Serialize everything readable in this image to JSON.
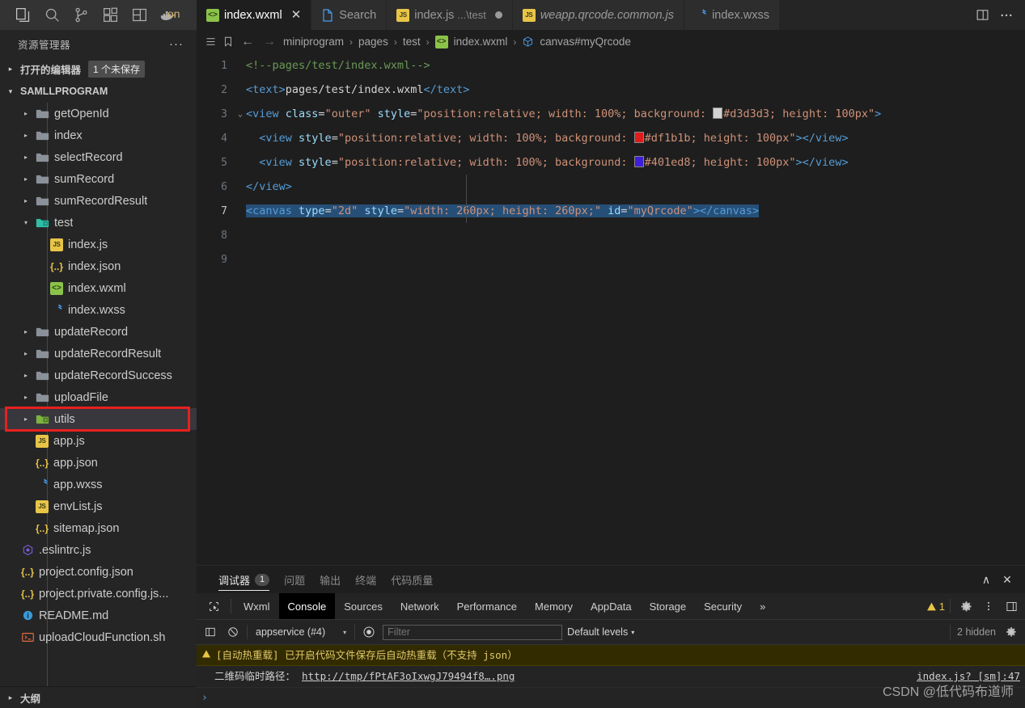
{
  "activity_bar": {
    "icons": [
      "explorer-icon",
      "search-icon",
      "source-control-icon",
      "extensions-icon",
      "layout-icon",
      "docker-icon"
    ],
    "overflow_label": "on"
  },
  "tabs": [
    {
      "label": "index.wxml",
      "sublabel": "",
      "icon": "wxml-file-icon",
      "active": true,
      "close": "✕",
      "dirty": false,
      "italic": false
    },
    {
      "label": "Search",
      "sublabel": "",
      "icon": "page-file-icon",
      "active": false,
      "close": "",
      "dirty": false,
      "italic": false
    },
    {
      "label": "index.js",
      "sublabel": "...\\test",
      "icon": "js-file-icon",
      "active": false,
      "close": "",
      "dirty": true,
      "italic": false
    },
    {
      "label": "weapp.qrcode.common.js",
      "sublabel": "",
      "icon": "js-file-icon",
      "active": false,
      "close": "",
      "dirty": false,
      "italic": true
    },
    {
      "label": "index.wxss",
      "sublabel": "",
      "icon": "wxss-file-icon",
      "active": false,
      "close": "",
      "dirty": false,
      "italic": false
    }
  ],
  "tab_actions": [
    "split-editor-icon",
    "more-actions-icon"
  ],
  "sidebar": {
    "title": "资源管理器",
    "more_label": "···",
    "open_editors": {
      "label": "打开的编辑器",
      "badge": "1 个未保存",
      "twisty": "▸"
    },
    "project": {
      "label": "SAMLLPROGRAM",
      "twisty": "▾"
    },
    "outline": {
      "label": "大纲",
      "twisty": "▸"
    },
    "tree": [
      {
        "label": "getOpenId",
        "type": "folder",
        "depth": 2,
        "twisty": "▸",
        "selected": false
      },
      {
        "label": "index",
        "type": "folder",
        "depth": 2,
        "twisty": "▸",
        "selected": false
      },
      {
        "label": "selectRecord",
        "type": "folder",
        "depth": 2,
        "twisty": "▸",
        "selected": false
      },
      {
        "label": "sumRecord",
        "type": "folder",
        "depth": 2,
        "twisty": "▸",
        "selected": false
      },
      {
        "label": "sumRecordResult",
        "type": "folder",
        "depth": 2,
        "twisty": "▸",
        "selected": false
      },
      {
        "label": "test",
        "type": "folder-open-active",
        "depth": 2,
        "twisty": "▾",
        "selected": false
      },
      {
        "label": "index.js",
        "type": "js",
        "depth": 3,
        "twisty": "",
        "selected": false
      },
      {
        "label": "index.json",
        "type": "json",
        "depth": 3,
        "twisty": "",
        "selected": false
      },
      {
        "label": "index.wxml",
        "type": "wxml",
        "depth": 3,
        "twisty": "",
        "selected": false
      },
      {
        "label": "index.wxss",
        "type": "wxss",
        "depth": 3,
        "twisty": "",
        "selected": false
      },
      {
        "label": "updateRecord",
        "type": "folder",
        "depth": 2,
        "twisty": "▸",
        "selected": false
      },
      {
        "label": "updateRecordResult",
        "type": "folder",
        "depth": 2,
        "twisty": "▸",
        "selected": false
      },
      {
        "label": "updateRecordSuccess",
        "type": "folder",
        "depth": 2,
        "twisty": "▸",
        "selected": false
      },
      {
        "label": "uploadFile",
        "type": "folder",
        "depth": 2,
        "twisty": "▸",
        "selected": false
      },
      {
        "label": "utils",
        "type": "folder-green",
        "depth": 2,
        "twisty": "▸",
        "selected": true
      },
      {
        "label": "app.js",
        "type": "js",
        "depth": 2,
        "twisty": "",
        "selected": false
      },
      {
        "label": "app.json",
        "type": "json",
        "depth": 2,
        "twisty": "",
        "selected": false
      },
      {
        "label": "app.wxss",
        "type": "wxss",
        "depth": 2,
        "twisty": "",
        "selected": false
      },
      {
        "label": "envList.js",
        "type": "js",
        "depth": 2,
        "twisty": "",
        "selected": false
      },
      {
        "label": "sitemap.json",
        "type": "json",
        "depth": 2,
        "twisty": "",
        "selected": false
      },
      {
        "label": ".eslintrc.js",
        "type": "eslint",
        "depth": 1,
        "twisty": "",
        "selected": false
      },
      {
        "label": "project.config.json",
        "type": "json",
        "depth": 1,
        "twisty": "",
        "selected": false
      },
      {
        "label": "project.private.config.js...",
        "type": "json",
        "depth": 1,
        "twisty": "",
        "selected": false
      },
      {
        "label": "README.md",
        "type": "md",
        "depth": 1,
        "twisty": "",
        "selected": false
      },
      {
        "label": "uploadCloudFunction.sh",
        "type": "sh",
        "depth": 1,
        "twisty": "",
        "selected": false
      }
    ],
    "highlight_color": "#e8201e"
  },
  "breadcrumbs": {
    "toggle_icon": "list-icon",
    "bookmark_icon": "bookmark-icon",
    "back_icon": "←",
    "forward_icon": "→",
    "items": [
      "miniprogram",
      "pages",
      "test",
      "index.wxml",
      "canvas#myQrcode"
    ],
    "separator": "›"
  },
  "editor": {
    "lines": [
      {
        "no": "1",
        "fold": "",
        "selected": false
      },
      {
        "no": "2",
        "fold": "",
        "selected": false
      },
      {
        "no": "3",
        "fold": "⌄",
        "selected": false
      },
      {
        "no": "4",
        "fold": "",
        "selected": false
      },
      {
        "no": "5",
        "fold": "",
        "selected": false
      },
      {
        "no": "6",
        "fold": "",
        "selected": false
      },
      {
        "no": "7",
        "fold": "",
        "selected": true
      },
      {
        "no": "8",
        "fold": "",
        "selected": false
      },
      {
        "no": "9",
        "fold": "",
        "selected": false
      }
    ],
    "line1_comment": "<!--pages/test/index.wxml-->",
    "line2": {
      "open": "<text>",
      "text": "pages/test/index.wxml",
      "close": "</text>"
    },
    "line3": {
      "tag_open": "<view",
      "attr1": "class",
      "val1": "\"outer\"",
      "attr2": "style",
      "style_prefix": "\"position:relative; width: 100%; background: ",
      "color": "#d3d3d3",
      "style_suffix": "; height: 100px\"",
      "tag_close": ">"
    },
    "line4": {
      "tag_open": "<view",
      "attr": "style",
      "style_prefix": "\"position:relative; width: 100%; background: ",
      "color": "#df1b1b",
      "style_suffix": "; height: 100px\"",
      "tag_close": ">",
      "closing": "</view>"
    },
    "line5": {
      "tag_open": "<view",
      "attr": "style",
      "style_prefix": "\"position:relative; width: 100%; background: ",
      "color": "#401ed8",
      "style_suffix": "; height: 100px\"",
      "tag_close": ">",
      "closing": "</view>"
    },
    "line6": "</view>",
    "line7": {
      "tag_open": "<canvas",
      "attr1": "type",
      "val1": "\"2d\"",
      "attr2": "style",
      "val2": "\"width: 260px; height: 260px;\"",
      "attr3": "id",
      "val3": "\"myQrcode\"",
      "tag_close": ">",
      "closing": "</canvas>"
    }
  },
  "panel": {
    "tabs": [
      {
        "label": "调试器",
        "badge": "1",
        "active": true
      },
      {
        "label": "问题",
        "badge": "",
        "active": false
      },
      {
        "label": "输出",
        "badge": "",
        "active": false
      },
      {
        "label": "终端",
        "badge": "",
        "active": false
      },
      {
        "label": "代码质量",
        "badge": "",
        "active": false
      }
    ],
    "actions": [
      "collapse-panel-icon",
      "close-panel-icon"
    ],
    "collapse_glyph": "∧",
    "close_glyph": "✕"
  },
  "devtools": {
    "inspect_icon": "inspect-element-icon",
    "tabs": [
      {
        "label": "Wxml",
        "active": false
      },
      {
        "label": "Console",
        "active": true
      },
      {
        "label": "Sources",
        "active": false
      },
      {
        "label": "Network",
        "active": false
      },
      {
        "label": "Performance",
        "active": false
      },
      {
        "label": "Memory",
        "active": false
      },
      {
        "label": "AppData",
        "active": false
      },
      {
        "label": "Storage",
        "active": false
      },
      {
        "label": "Security",
        "active": false
      }
    ],
    "overflow": "»",
    "warning_count": "1",
    "settings_icon": "gear-icon",
    "more_icon": "kebab-menu-icon",
    "dock_icon": "dock-panel-icon",
    "toolbar": {
      "clear_icon": "clear-console-icon",
      "sidebar_icon": "console-sidebar-icon",
      "context": "appservice (#4)",
      "context_caret": "▾",
      "eye_icon": "live-expression-icon",
      "filter_placeholder": "Filter",
      "filter_value": "",
      "levels": "Default levels",
      "levels_caret": "▾",
      "hidden": "2 hidden",
      "settings_icon": "console-settings-icon"
    },
    "messages": [
      {
        "kind": "warning",
        "icon": "warning-triangle-icon",
        "text": "[自动热重载] 已开启代码文件保存后自动热重载（不支持 json）",
        "source": ""
      },
      {
        "kind": "log",
        "icon": "",
        "text": "二维码临时路径：",
        "link": "http://tmp/fPtAF3oIxwgJ79494f8….png",
        "source": "index.js? [sm]:47"
      }
    ],
    "prompt": "›"
  },
  "watermark": "CSDN @低代码布道师"
}
